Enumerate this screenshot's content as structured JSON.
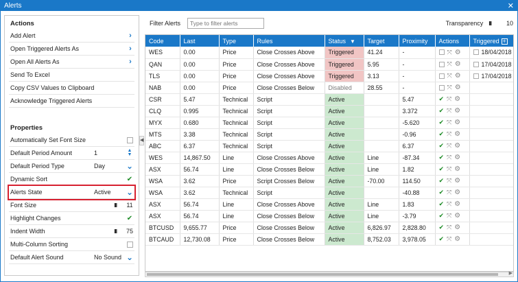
{
  "window": {
    "title": "Alerts",
    "close_glyph": "✕"
  },
  "actions": {
    "title": "Actions",
    "items": [
      {
        "label": "Add Alert",
        "has_chevron": true
      },
      {
        "label": "Open Triggered Alerts As",
        "has_chevron": true
      },
      {
        "label": "Open All Alerts As",
        "has_chevron": true
      },
      {
        "label": "Send To Excel",
        "has_chevron": false
      },
      {
        "label": "Copy CSV Values to Clipboard",
        "has_chevron": false
      },
      {
        "label": "Acknowledge Triggered Alerts",
        "has_chevron": false
      }
    ]
  },
  "properties": {
    "title": "Properties",
    "items": [
      {
        "label": "Automatically Set Font Size",
        "value": "",
        "control": "checkbox-off"
      },
      {
        "label": "Default Period Amount",
        "value": "1",
        "control": "spinner"
      },
      {
        "label": "Default Period Type",
        "value": "Day",
        "control": "dropdown"
      },
      {
        "label": "Dynamic Sort",
        "value": "",
        "control": "checkbox-on"
      },
      {
        "label": "Alerts State",
        "value": "Active",
        "control": "dropdown",
        "highlighted": true
      },
      {
        "label": "Font Size",
        "value": "III",
        "value2": "11",
        "control": "grip"
      },
      {
        "label": "Highlight Changes",
        "value": "",
        "control": "checkbox-on"
      },
      {
        "label": "Indent Width",
        "value": "III",
        "value2": "75",
        "control": "grip"
      },
      {
        "label": "Multi-Column Sorting",
        "value": "",
        "control": "checkbox-off"
      },
      {
        "label": "Default Alert Sound",
        "value": "No Sound",
        "control": "dropdown"
      }
    ]
  },
  "filter": {
    "label": "Filter Alerts",
    "placeholder": "Type to filter alerts"
  },
  "transparency": {
    "label": "Transparency",
    "grip": "III",
    "value": "10"
  },
  "table": {
    "columns": [
      "Code",
      "Last",
      "Type",
      "Rules",
      "Status",
      "Target",
      "Proximity",
      "Actions",
      "Triggered"
    ],
    "rows": [
      {
        "code": "WES",
        "last": "0.00",
        "type": "Price",
        "rules": "Close Crosses Above",
        "status": "Triggered",
        "target": "41.24",
        "proximity": "-",
        "checked": false,
        "triggered": "18/04/2018"
      },
      {
        "code": "QAN",
        "last": "0.00",
        "type": "Price",
        "rules": "Close Crosses Above",
        "status": "Triggered",
        "target": "5.95",
        "proximity": "-",
        "checked": false,
        "triggered": "17/04/2018"
      },
      {
        "code": "TLS",
        "last": "0.00",
        "type": "Price",
        "rules": "Close Crosses Above",
        "status": "Triggered",
        "target": "3.13",
        "proximity": "-",
        "checked": false,
        "triggered": "17/04/2018"
      },
      {
        "code": "NAB",
        "last": "0.00",
        "type": "Price",
        "rules": "Close Crosses Below",
        "status": "Disabled",
        "target": "28.55",
        "proximity": "-",
        "checked": false,
        "triggered": ""
      },
      {
        "code": "CSR",
        "last": "5.47",
        "type": "Technical",
        "rules": "Script",
        "status": "Active",
        "target": "",
        "proximity": "5.47",
        "checked": true,
        "triggered": ""
      },
      {
        "code": "CLQ",
        "last": "0.995",
        "type": "Technical",
        "rules": "Script",
        "status": "Active",
        "target": "",
        "proximity": "3.372",
        "checked": true,
        "triggered": ""
      },
      {
        "code": "MYX",
        "last": "0.680",
        "type": "Technical",
        "rules": "Script",
        "status": "Active",
        "target": "",
        "proximity": "-5.620",
        "checked": true,
        "triggered": ""
      },
      {
        "code": "MTS",
        "last": "3.38",
        "type": "Technical",
        "rules": "Script",
        "status": "Active",
        "target": "",
        "proximity": "-0.96",
        "checked": true,
        "triggered": ""
      },
      {
        "code": "ABC",
        "last": "6.37",
        "type": "Technical",
        "rules": "Script",
        "status": "Active",
        "target": "",
        "proximity": "6.37",
        "checked": true,
        "triggered": ""
      },
      {
        "code": "WES",
        "last": "14,867.50",
        "type": "Line",
        "rules": "Close Crosses Above",
        "status": "Active",
        "target": "Line",
        "proximity": "-87.34",
        "checked": true,
        "triggered": ""
      },
      {
        "code": "ASX",
        "last": "56.74",
        "type": "Line",
        "rules": "Close Crosses Below",
        "status": "Active",
        "target": "Line",
        "proximity": "1.82",
        "checked": true,
        "triggered": ""
      },
      {
        "code": "WSA",
        "last": "3.62",
        "type": "Price",
        "rules": "Script Crosses Below",
        "status": "Active",
        "target": "-70.00",
        "proximity": "114.50",
        "checked": true,
        "triggered": ""
      },
      {
        "code": "WSA",
        "last": "3.62",
        "type": "Technical",
        "rules": "Script",
        "status": "Active",
        "target": "",
        "proximity": "-40.88",
        "checked": true,
        "triggered": ""
      },
      {
        "code": "ASX",
        "last": "56.74",
        "type": "Line",
        "rules": "Close Crosses Above",
        "status": "Active",
        "target": "Line",
        "proximity": "1.83",
        "checked": true,
        "triggered": ""
      },
      {
        "code": "ASX",
        "last": "56.74",
        "type": "Line",
        "rules": "Close Crosses Below",
        "status": "Active",
        "target": "Line",
        "proximity": "-3.79",
        "checked": true,
        "triggered": ""
      },
      {
        "code": "BTCUSD",
        "last": "9,655.77",
        "type": "Price",
        "rules": "Close Crosses Below",
        "status": "Active",
        "target": "6,826.97",
        "proximity": "2,828.80",
        "checked": true,
        "triggered": ""
      },
      {
        "code": "BTCAUD",
        "last": "12,730.08",
        "type": "Price",
        "rules": "Close Crosses Below",
        "status": "Active",
        "target": "8,752.03",
        "proximity": "3,978.05",
        "checked": true,
        "triggered": ""
      }
    ]
  },
  "colors": {
    "accent": "#1a78c8",
    "triggered": "#f1c5c4",
    "active": "#cce9cf",
    "highlight": "#d7202f"
  }
}
